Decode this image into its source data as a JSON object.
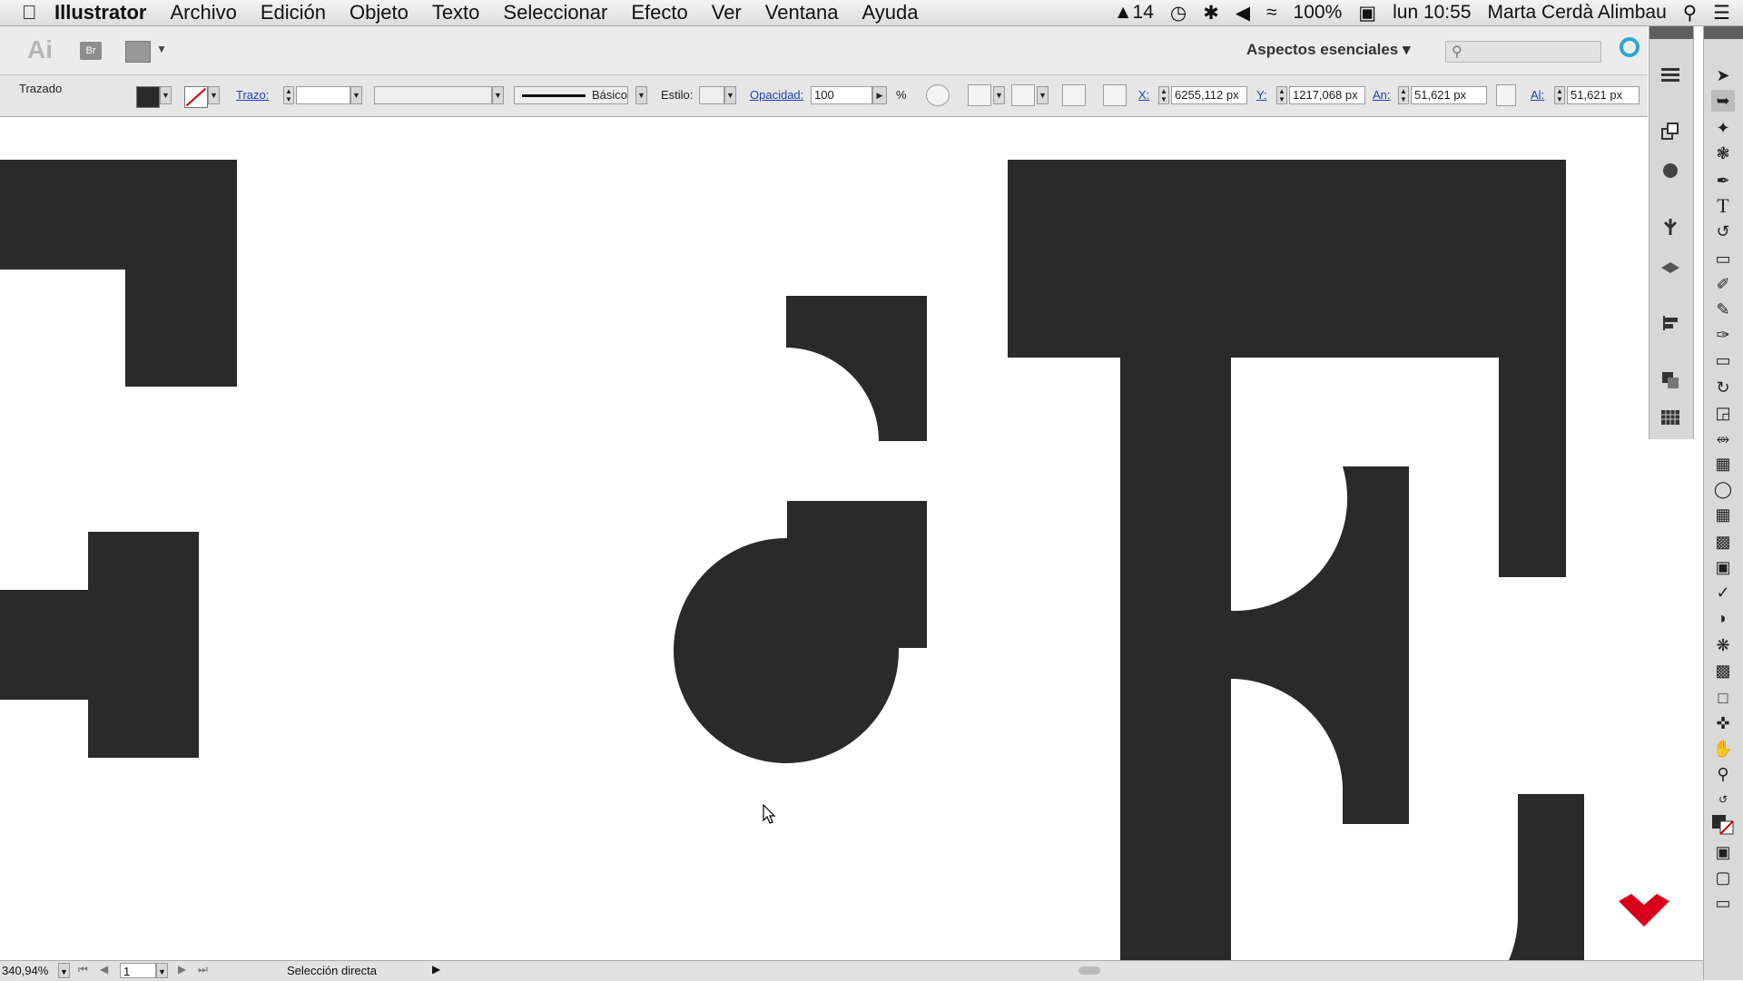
{
  "mac_menubar": {
    "app_name": "Illustrator",
    "menus": [
      "Archivo",
      "Edición",
      "Objeto",
      "Texto",
      "Seleccionar",
      "Efecto",
      "Ver",
      "Ventana",
      "Ayuda"
    ],
    "status_adobe": "14",
    "battery": "100%",
    "clock": "lun 10:55",
    "user": "Marta Cerdà Alimbau"
  },
  "app_bar": {
    "logo": "Ai",
    "bridge": "Br",
    "workspace": "Aspectos esenciales"
  },
  "control_bar": {
    "object_type": "Trazado",
    "stroke_label": "Trazo:",
    "brush_label": "Básico",
    "style_label": "Estilo:",
    "opacity_label": "Opacidad:",
    "opacity_value": "100",
    "percent": "%",
    "x_label": "X:",
    "x_value": "6255,112 px",
    "y_label": "Y:",
    "y_value": "1217,068 px",
    "w_label": "An:",
    "w_value": "51,621 px",
    "h_label": "Al:",
    "h_value": "51,621 px"
  },
  "status_bar": {
    "zoom": "340,94%",
    "artboard": "1",
    "tool": "Selección directa"
  },
  "colors": {
    "artwork": "#2b2a2a",
    "brand": "#d9001b",
    "sync": "#2aa7d4"
  }
}
